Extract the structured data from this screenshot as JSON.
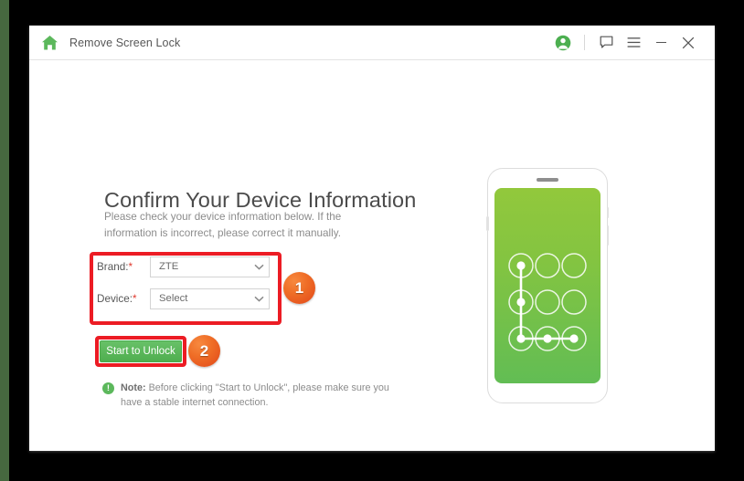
{
  "window": {
    "title": "Remove Screen Lock",
    "home_icon": "home-icon"
  },
  "titlebar": {
    "account_icon": "account-icon",
    "feedback_icon": "feedback-chat-icon",
    "menu_icon": "hamburger-menu-icon",
    "minimize_icon": "minimize-icon",
    "close_icon": "close-icon"
  },
  "main": {
    "heading": "Confirm Your Device Information",
    "subtitle": "Please check your device information below. If the information is incorrect, please correct it manually."
  },
  "form": {
    "fields": [
      {
        "label": "Brand:",
        "required_mark": "*",
        "value": "ZTE",
        "chevron": "chevron-down-icon"
      },
      {
        "label": "Device:",
        "required_mark": "*",
        "value": "Select",
        "chevron": "chevron-down-icon"
      }
    ]
  },
  "action": {
    "unlock_label": "Start to Unlock"
  },
  "badges": {
    "step_one": "1",
    "step_two": "2"
  },
  "note": {
    "icon": "info-exclamation-icon",
    "icon_glyph": "!",
    "prefix": "Note:",
    "text": " Before clicking \"Start to Unlock\", please make sure you have a stable internet connection."
  },
  "phone": {
    "alt": "phone-with-pattern-lock",
    "pattern_sequence": [
      1,
      4,
      7,
      8,
      9
    ]
  },
  "colors": {
    "accent_green": "#5cb85c",
    "highlight_red": "#ec1c24",
    "badge_orange": "#ef6d26",
    "required_red": "#e03a2f",
    "screen_green_top": "#92c83c",
    "screen_green_bottom": "#62bd54"
  }
}
